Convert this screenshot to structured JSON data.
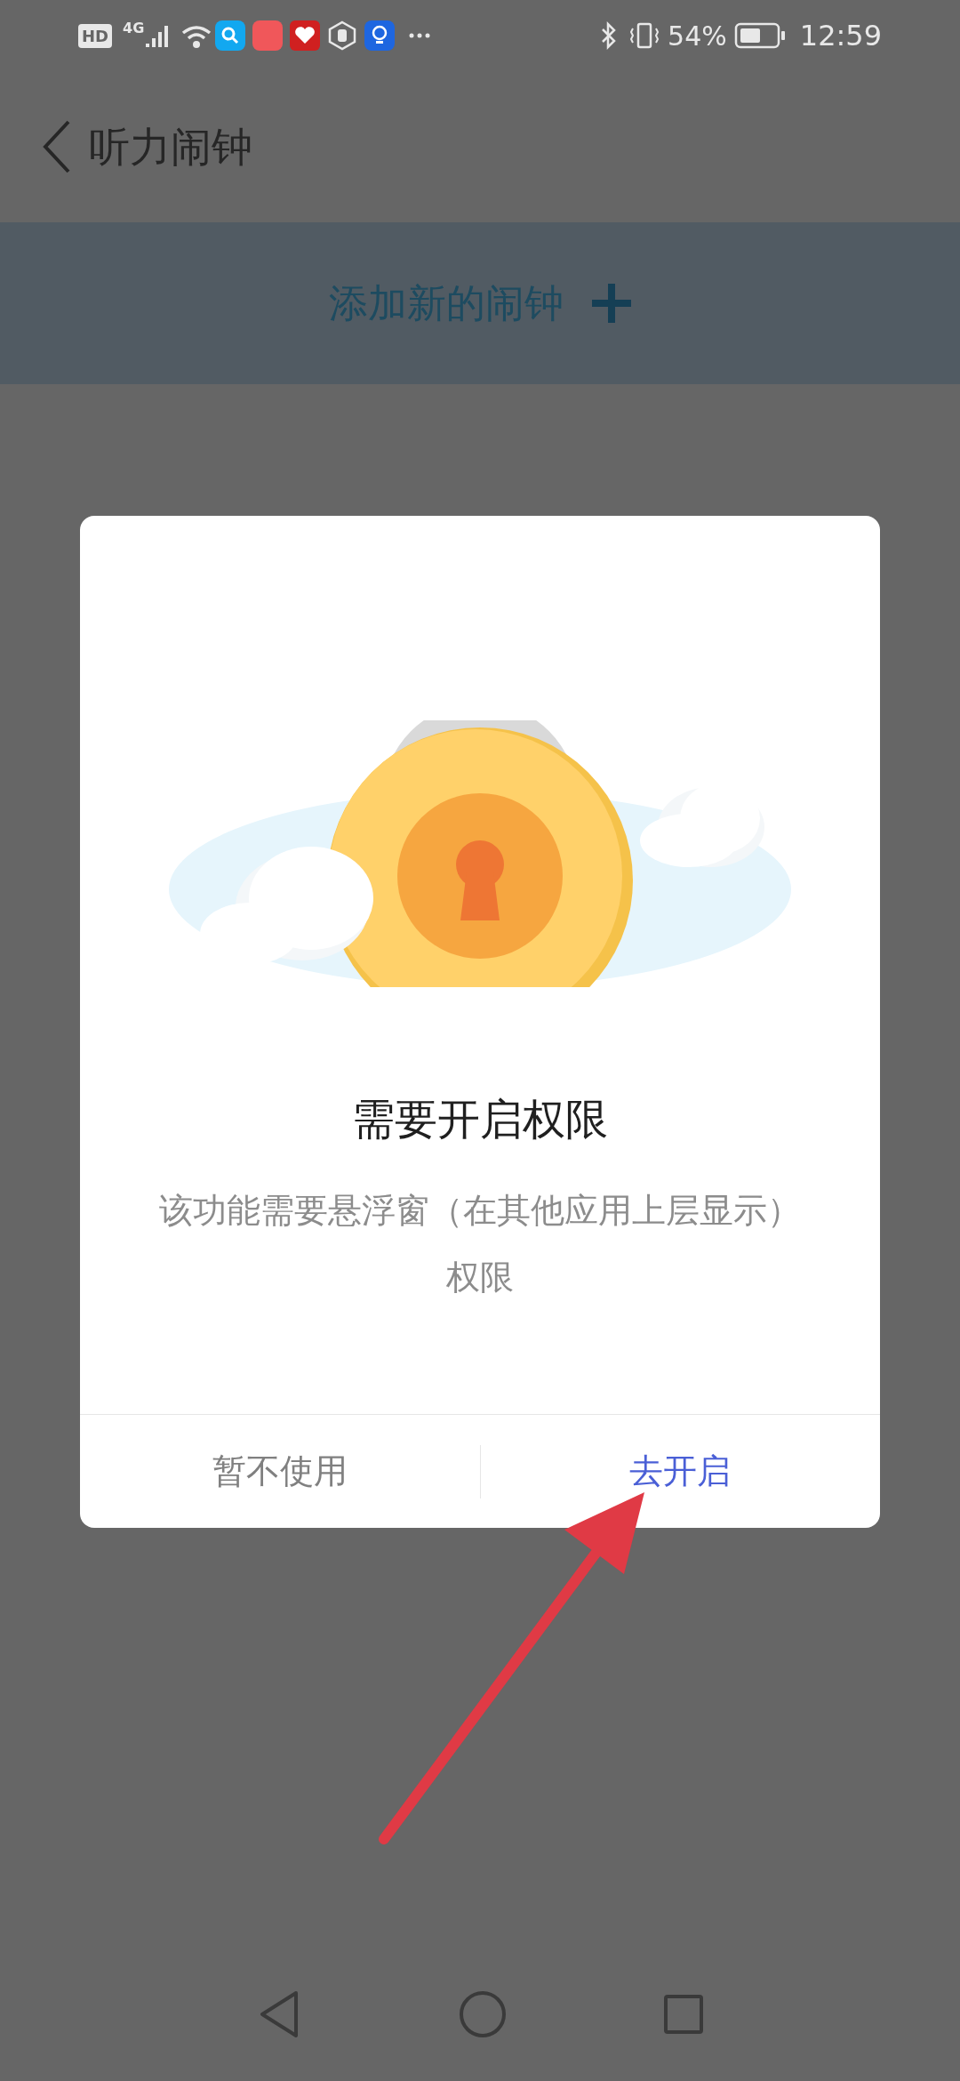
{
  "status_bar": {
    "hd": "HD",
    "network": "4G",
    "battery": "54%",
    "time": "12:59"
  },
  "header": {
    "title": "听力闹钟"
  },
  "add_banner": {
    "label": "添加新的闹钟"
  },
  "dialog": {
    "title": "需要开启权限",
    "message": "该功能需要悬浮窗（在其他应用上层显示）权限",
    "buttons": [
      {
        "label": "暂不使用",
        "emphasized": false
      },
      {
        "label": "去开启",
        "emphasized": true
      }
    ]
  }
}
